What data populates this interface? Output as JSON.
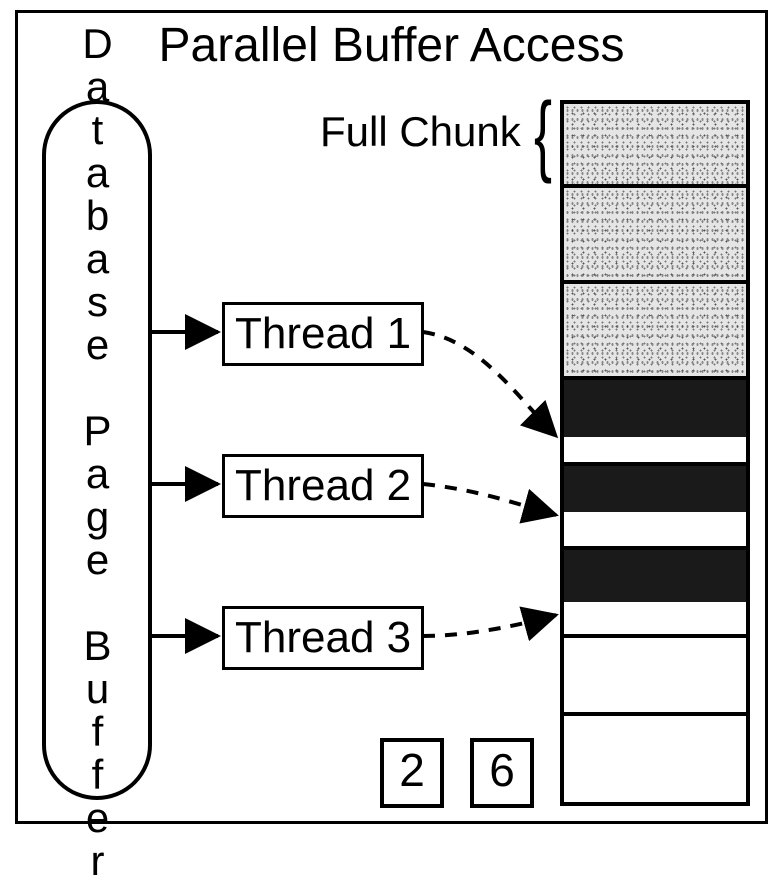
{
  "title": "Parallel Buffer Access",
  "buffer_label": "Database Page Buffer",
  "threads": [
    {
      "label": "Thread 1"
    },
    {
      "label": "Thread 2"
    },
    {
      "label": "Thread 3"
    }
  ],
  "full_chunk_label": "Full Chunk",
  "numbers": {
    "free_chunks": "2",
    "total_chunks_used": "6"
  },
  "stack": [
    {
      "state": "full"
    },
    {
      "state": "full"
    },
    {
      "state": "full"
    },
    {
      "state": "partial",
      "thread": 1
    },
    {
      "state": "partial",
      "thread": 2
    },
    {
      "state": "partial",
      "thread": 3
    },
    {
      "state": "empty"
    },
    {
      "state": "empty"
    }
  ]
}
